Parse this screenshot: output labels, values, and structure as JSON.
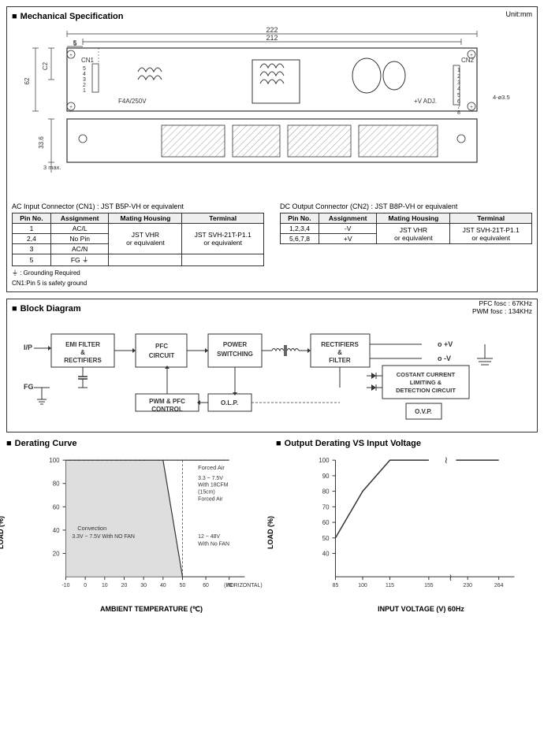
{
  "sections": {
    "mechanical": {
      "title": "Mechanical Specification",
      "unit": "Unit:mm",
      "dim_222": "222",
      "dim_212": "212",
      "dim_62": "62",
      "dim_c2": "C2",
      "dim_cn1": "CN1",
      "dim_33_6": "33.6",
      "dim_3max": "3 max.",
      "dim_5": "5",
      "fuse": "F4A/250V",
      "vadj": "+V ADJ.",
      "cn2": "CN2",
      "dim_4x35": "4-ø3.5"
    },
    "connectors": {
      "ac_title": "AC Input Connector (CN1) : JST B5P-VH or equivalent",
      "dc_title": "DC Output Connector (CN2) : JST B8P-VH or equivalent",
      "ac_headers": [
        "Pin No.",
        "Assignment",
        "Mating Housing",
        "Terminal"
      ],
      "ac_rows": [
        [
          "1",
          "AC/L",
          "",
          ""
        ],
        [
          "2,4",
          "No Pin",
          "JST VHR\nor equivalent",
          "JST SVH-21T-P1.1\nor equivalent"
        ],
        [
          "3",
          "AC/N",
          "",
          ""
        ],
        [
          "5",
          "FG ⏚",
          "",
          ""
        ]
      ],
      "dc_headers": [
        "Pin No.",
        "Assignment",
        "Mating Housing",
        "Terminal"
      ],
      "dc_rows": [
        [
          "1,2,3,4",
          "-V",
          "JST VHR\nor equivalent",
          "JST SVH-21T-P1.1\nor equivalent"
        ],
        [
          "5,6,7,8",
          "+V",
          "",
          ""
        ]
      ],
      "note1": "⏚ : Grounding Required",
      "note2": "CN1:Pin 5 is safety ground"
    },
    "block_diagram": {
      "title": "Block Diagram",
      "fosc1": "PFC fosc : 67KHz",
      "fosc2": "PWM fosc : 134KHz",
      "ip_label": "I/P",
      "fg_label": "FG",
      "vplus_label": "+V",
      "vminus_label": "-V",
      "blocks": [
        {
          "id": "emi",
          "label": "EMI FILTER\n& \nRECTIFIERS"
        },
        {
          "id": "pfc",
          "label": "PFC\nCIRCUIT"
        },
        {
          "id": "power",
          "label": "POWER\nSWITCHING"
        },
        {
          "id": "rect",
          "label": "RECTIFIERS\n&\nFILTER"
        },
        {
          "id": "olp",
          "label": "O.L.P."
        },
        {
          "id": "pwm",
          "label": "PWM & PFC\nCONTROL"
        },
        {
          "id": "cc",
          "label": "COSTANT CURRENT\nLIMITING &\nDETECTION CIRCUIT"
        },
        {
          "id": "ovp",
          "label": "O.V.P."
        }
      ]
    },
    "derating": {
      "title": "Derating Curve",
      "output_title": "Output Derating VS Input Voltage",
      "y_axis": "LOAD (%)",
      "x_axis_left": "AMBIENT TEMPERATURE (℃)",
      "x_axis_right": "INPUT VOLTAGE (V) 60Hz",
      "left_annotations": [
        "Forced Air",
        "3.3 ~ 7.5V\nWith 18CFM\n(15cm)\nForced Air",
        "Convection\n3.3V ~ 7.5V With NO FAN",
        "12 ~ 48V\nWith No FAN"
      ],
      "left_y_ticks": [
        "100",
        "80",
        "60",
        "40",
        "20"
      ],
      "left_x_ticks": [
        "-10",
        "0",
        "10",
        "20",
        "30",
        "40",
        "50",
        "60",
        "70"
      ],
      "left_x_label": "(HORIZONTAL)",
      "right_y_ticks": [
        "100",
        "90",
        "80",
        "70",
        "60",
        "50",
        "40"
      ],
      "right_x_ticks": [
        "85",
        "100",
        "115",
        "155",
        "230",
        "264"
      ]
    }
  }
}
